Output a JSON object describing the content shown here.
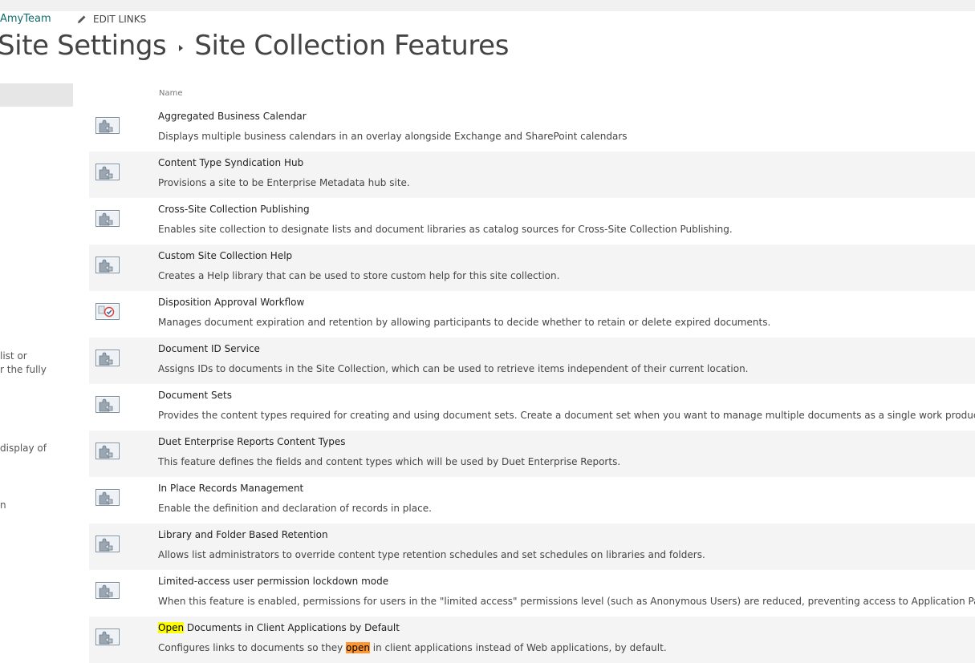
{
  "header": {
    "site_link": "AmyTeam",
    "edit_links": "EDIT LINKS",
    "breadcrumb_parent": "Site Settings",
    "breadcrumb_current": "Site Collection Features"
  },
  "left_nav_fragments": [
    "list or",
    "r the fully",
    "display of",
    "n"
  ],
  "table": {
    "column_header": "Name",
    "features": [
      {
        "name": "Aggregated Business Calendar",
        "description": "Displays multiple business calendars in an overlay alongside Exchange and SharePoint calendars",
        "icon": "feature-puzzle-icon"
      },
      {
        "name": "Content Type Syndication Hub",
        "description": "Provisions a site to be Enterprise Metadata hub site.",
        "icon": "feature-puzzle-icon"
      },
      {
        "name": "Cross-Site Collection Publishing",
        "description": "Enables site collection to designate lists and document libraries as catalog sources for Cross-Site Collection Publishing.",
        "icon": "feature-puzzle-icon"
      },
      {
        "name": "Custom Site Collection Help",
        "description": "Creates a Help library that can be used to store custom help for this site collection.",
        "icon": "feature-puzzle-icon"
      },
      {
        "name": "Disposition Approval Workflow",
        "description": "Manages document expiration and retention by allowing participants to decide whether to retain or delete expired documents.",
        "icon": "workflow-check-icon"
      },
      {
        "name": "Document ID Service",
        "description": "Assigns IDs to documents in the Site Collection, which can be used to retrieve items independent of their current location.",
        "icon": "feature-puzzle-icon"
      },
      {
        "name": "Document Sets",
        "description": "Provides the content types required for creating and using document sets. Create a document set when you want to manage multiple documents as a single work product.",
        "icon": "feature-puzzle-icon"
      },
      {
        "name": "Duet Enterprise Reports Content Types",
        "description": "This feature defines the fields and content types which will be used by Duet Enterprise Reports.",
        "icon": "feature-puzzle-icon"
      },
      {
        "name": "In Place Records Management",
        "description": "Enable the definition and declaration of records in place.",
        "icon": "feature-puzzle-icon"
      },
      {
        "name": "Library and Folder Based Retention",
        "description": "Allows list administrators to override content type retention schedules and set schedules on libraries and folders.",
        "icon": "feature-puzzle-icon"
      },
      {
        "name": "Limited-access user permission lockdown mode",
        "description": "When this feature is enabled, permissions for users in the \"limited access\" permissions level (such as Anonymous Users) are reduced, preventing access to Application Pages.",
        "icon": "feature-puzzle-icon"
      },
      {
        "name": "Open Documents in Client Applications by Default",
        "description": "Configures links to documents so they open in client applications instead of Web applications, by default.",
        "icon": "feature-puzzle-icon"
      }
    ],
    "last_row_parts": {
      "name_highlight": "Open",
      "name_rest": " Documents in Client Applications by Default",
      "desc_before": "Configures links to documents so they ",
      "desc_highlight": "open",
      "desc_after": " in client applications instead of Web applications, by default."
    }
  },
  "colors": {
    "site_link": "#0f6b6b",
    "row_alt": "#f4f4f4",
    "search_hit": "#ffff00",
    "search_hit_current": "#ff9632"
  }
}
